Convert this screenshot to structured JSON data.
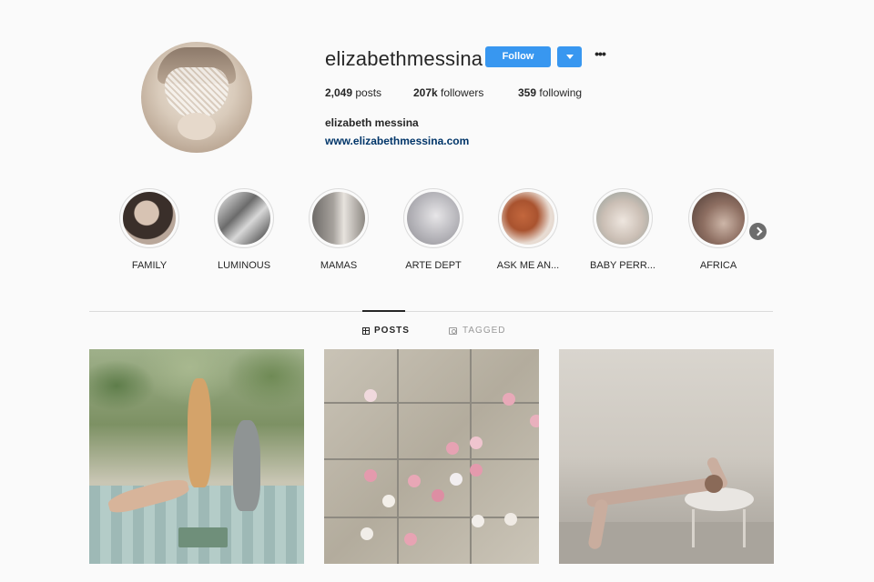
{
  "profile": {
    "username": "elizabethmessina",
    "follow_label": "Follow",
    "more_label": "•••",
    "stats": {
      "posts_count": "2,049",
      "posts_label": "posts",
      "followers_count": "207k",
      "followers_label": "followers",
      "following_count": "359",
      "following_label": "following"
    },
    "full_name": "elizabeth messina",
    "website": "www.elizabethmessina.com"
  },
  "highlights": [
    {
      "label": "FAMILY"
    },
    {
      "label": "LUMINOUS"
    },
    {
      "label": "MAMAS"
    },
    {
      "label": "ARTE DEPT"
    },
    {
      "label": "ASK ME AN..."
    },
    {
      "label": "BABY PERR..."
    },
    {
      "label": "AFRICA"
    }
  ],
  "tabs": {
    "posts_label": "POSTS",
    "tagged_label": "TAGGED"
  },
  "colors": {
    "accent": "#3897f0",
    "link": "#003569",
    "background": "#fafafa"
  },
  "icons": {
    "next": "chevron-right-icon",
    "posts_tab": "grid-icon",
    "tagged_tab": "tag-icon",
    "more": "ellipsis-icon",
    "dropdown": "caret-down-icon"
  }
}
